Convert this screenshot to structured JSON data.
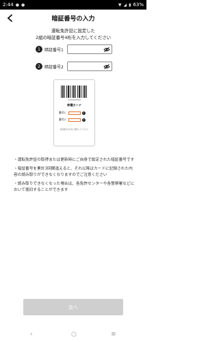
{
  "status_bar": {
    "time": "2:44",
    "battery": "63%"
  },
  "header": {
    "title": "暗証番号の入力",
    "back_icon": "chevron-left-icon"
  },
  "intro": {
    "line1": "運転免許証に設定した",
    "line2": "2組の暗証番号4桁を入力してください"
  },
  "fields": [
    {
      "number": "1",
      "label": "暗証番号1",
      "value": "",
      "placeholder": ""
    },
    {
      "number": "2",
      "label": "暗証番号2",
      "value": "",
      "placeholder": ""
    }
  ],
  "card": {
    "barcode_number": "1234567890",
    "title": "券種カード",
    "rows": [
      {
        "label": "番号1：",
        "number": "1"
      },
      {
        "label": "番号2：",
        "number": "2"
      }
    ],
    "note": "暗証番号は大切に保管してください"
  },
  "notes": [
    "・運転免許証の取得または更新時にご自身で設定された暗証番号です",
    "・暗証番号を累計3回間違えると、それ以降はカードに記録された内容の読み取りができなくなりますのでご注意ください",
    "・読み取りできなくなった場合は、各免許センターや各警察署などにおいて復旧することができます"
  ],
  "next_button": {
    "label": "次へ"
  },
  "colors": {
    "accent": "#e0702a",
    "button_disabled": "#cfcfcf"
  }
}
